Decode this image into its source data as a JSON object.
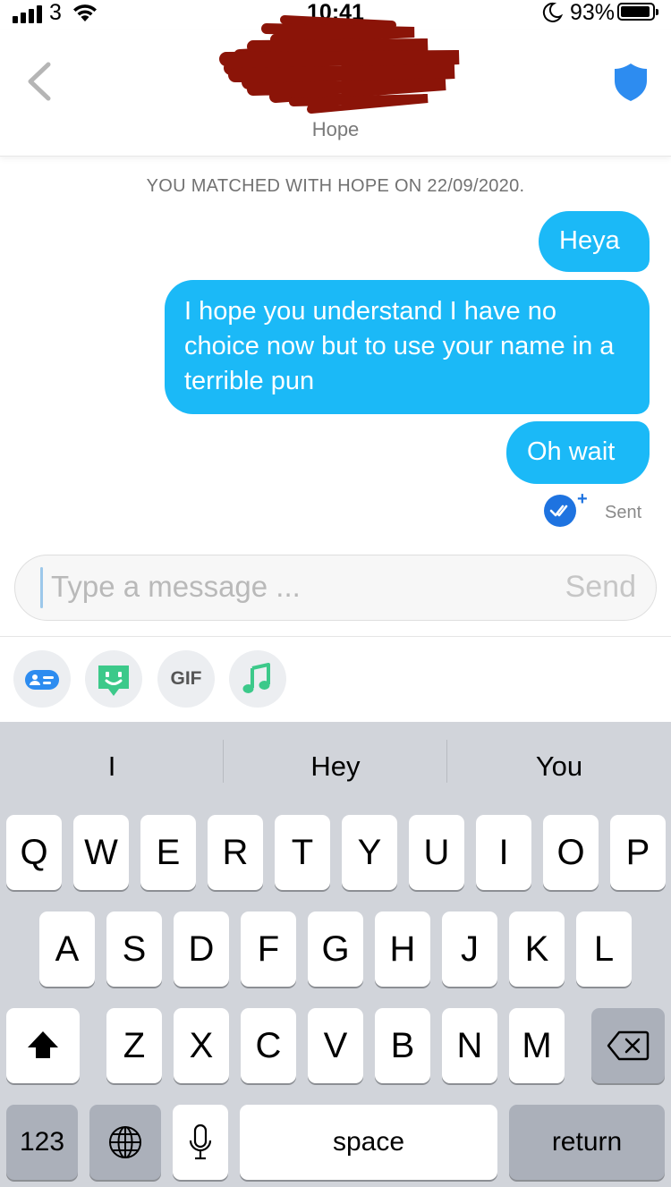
{
  "status_bar": {
    "carrier": "3",
    "time": "10:41",
    "battery": "93%"
  },
  "header": {
    "contact_name": "Hope"
  },
  "chat": {
    "match_notice": "YOU MATCHED WITH HOPE ON 22/09/2020.",
    "messages": [
      {
        "from": "me",
        "text": "Heya"
      },
      {
        "from": "me",
        "text": "I hope you understand I have no choice now but to use your name in a terrible pun"
      },
      {
        "from": "me",
        "text": "Oh wait"
      }
    ],
    "status": "Sent"
  },
  "composer": {
    "placeholder": "Type a message ...",
    "send_label": "Send"
  },
  "tools": {
    "gif_label": "GIF"
  },
  "keyboard": {
    "suggestions": [
      "I",
      "Hey",
      "You"
    ],
    "row1": [
      "Q",
      "W",
      "E",
      "R",
      "T",
      "Y",
      "U",
      "I",
      "O",
      "P"
    ],
    "row2": [
      "A",
      "S",
      "D",
      "F",
      "G",
      "H",
      "J",
      "K",
      "L"
    ],
    "row3": [
      "Z",
      "X",
      "C",
      "V",
      "B",
      "N",
      "M"
    ],
    "numbers_label": "123",
    "space_label": "space",
    "return_label": "return"
  },
  "colors": {
    "bubble": "#1bb9f7",
    "shield": "#2d8cf0",
    "sent_badge": "#1e73e0",
    "keyboard_bg": "#d1d4da"
  }
}
